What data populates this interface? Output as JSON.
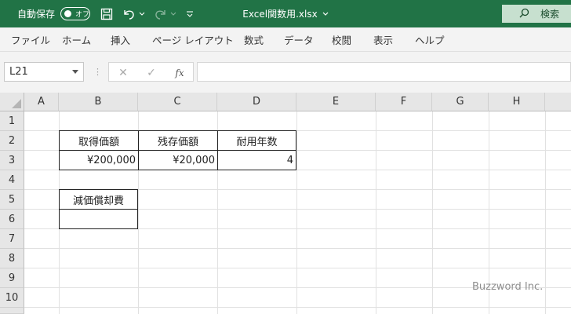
{
  "titlebar": {
    "autosave_label": "自動保存",
    "autosave_toggle": "オフ",
    "filename": "Excel関数用.xlsx",
    "search_label": "検索",
    "icons": [
      "save-icon",
      "undo-icon",
      "redo-icon",
      "customize-qat-icon",
      "search-icon"
    ]
  },
  "ribbon": {
    "tabs": [
      "ファイル",
      "ホーム",
      "挿入",
      "ページ レイアウト",
      "数式",
      "データ",
      "校閲",
      "表示",
      "ヘルプ"
    ]
  },
  "formula_bar": {
    "name_box": "L21",
    "fx_label": "fx",
    "formula": ""
  },
  "sheet": {
    "columns": [
      "A",
      "B",
      "C",
      "D",
      "E",
      "F",
      "G",
      "H"
    ],
    "rows": [
      "1",
      "2",
      "3",
      "4",
      "5",
      "6",
      "7",
      "8",
      "9",
      "10"
    ],
    "cells": {
      "B2": "取得価額",
      "C2": "残存価額",
      "D2": "耐用年数",
      "B3": "¥200,000",
      "C3": "¥20,000",
      "D3": "4",
      "B5": "減価償却費",
      "B6": ""
    }
  },
  "watermark": "Buzzword Inc.",
  "colors": {
    "title_bar": "#217346",
    "ribbon_bg": "#f3f3f3",
    "header_bg": "#e6e6e6",
    "gridline": "#e1e1e1"
  }
}
